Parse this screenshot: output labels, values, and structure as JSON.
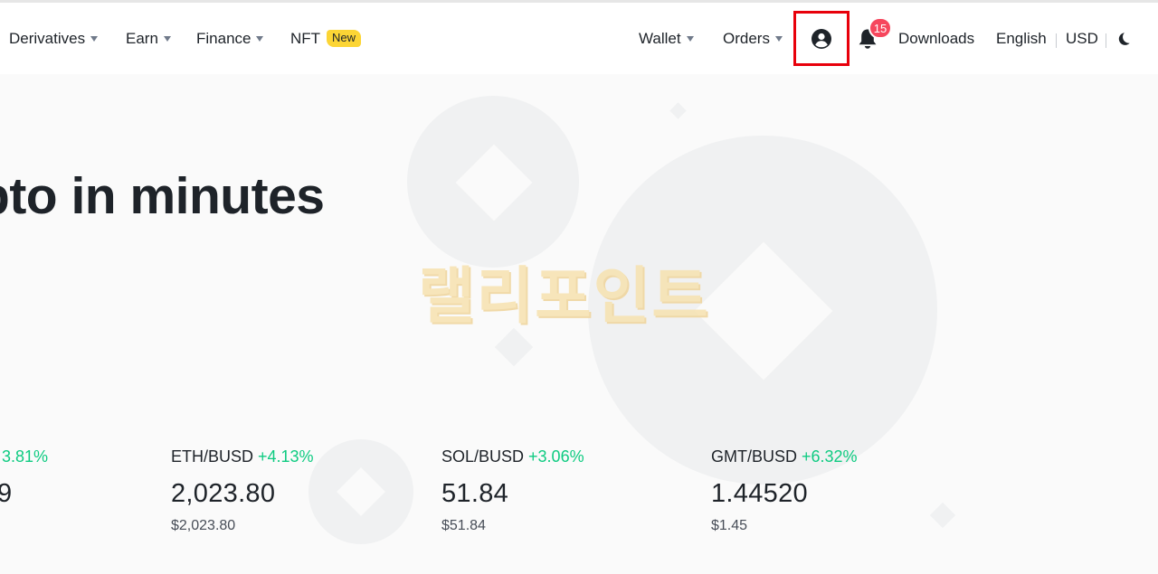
{
  "nav": {
    "left_items": [
      {
        "label": "Derivatives",
        "has_dropdown": true
      },
      {
        "label": "Earn",
        "has_dropdown": true
      },
      {
        "label": "Finance",
        "has_dropdown": true
      },
      {
        "label": "NFT",
        "badge": "New"
      }
    ],
    "right_items": {
      "wallet": "Wallet",
      "orders": "Orders",
      "notification_count": "15",
      "downloads": "Downloads",
      "language": "English",
      "currency": "USD"
    },
    "icons": [
      "user-circle-icon",
      "bell-icon",
      "moon-icon",
      "chevron-down-icon"
    ]
  },
  "hero": {
    "title": "pto in minutes",
    "watermark": "랠리포인트"
  },
  "tickers": [
    {
      "pair": "",
      "change": "3.81%",
      "price": "9",
      "usd": ""
    },
    {
      "pair": "ETH/BUSD",
      "change": "+4.13%",
      "price": "2,023.80",
      "usd": "$2,023.80"
    },
    {
      "pair": "SOL/BUSD",
      "change": "+3.06%",
      "price": "51.84",
      "usd": "$51.84"
    },
    {
      "pair": "GMT/BUSD",
      "change": "+6.32%",
      "price": "1.44520",
      "usd": "$1.45"
    }
  ],
  "colors": {
    "positive": "#0ecb81",
    "badge": "#fcd535",
    "notification": "#f6465d",
    "highlight": "#e8000b"
  }
}
